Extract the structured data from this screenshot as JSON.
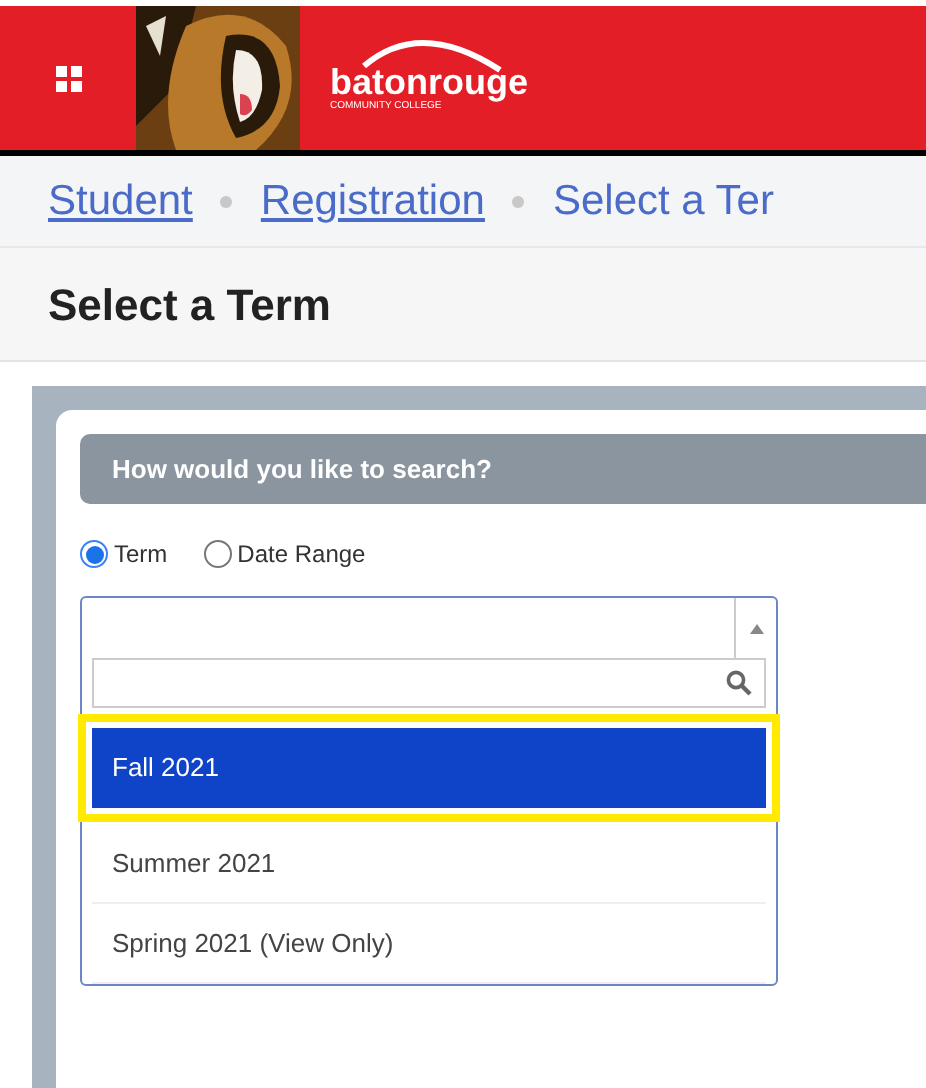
{
  "header": {
    "logo": {
      "name": "batonrouge",
      "subtitle": "COMMUNITY COLLEGE"
    }
  },
  "breadcrumb": [
    {
      "label": "Student",
      "kind": "link"
    },
    {
      "label": "Registration",
      "kind": "link"
    },
    {
      "label": "Select a Ter",
      "kind": "current"
    }
  ],
  "page_title": "Select a Term",
  "panel": {
    "heading": "How would you like to search?",
    "search_options": [
      {
        "label": "Term",
        "selected": true
      },
      {
        "label": "Date Range",
        "selected": false
      }
    ],
    "term_dropdown": {
      "expanded": true,
      "options": [
        {
          "label": "Fall 2021",
          "selected": true
        },
        {
          "label": "Summer 2021",
          "selected": false
        },
        {
          "label": "Spring 2021 (View Only)",
          "selected": false
        }
      ]
    }
  }
}
